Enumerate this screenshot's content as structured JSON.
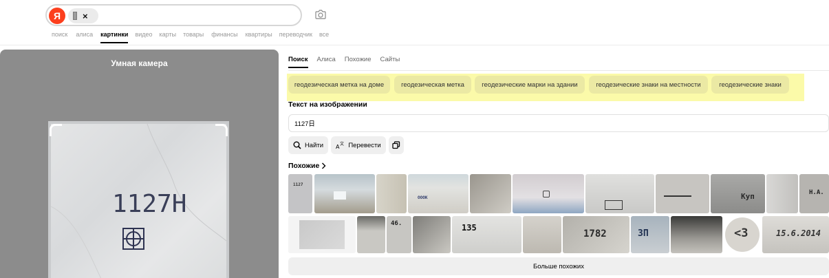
{
  "header": {
    "logo_letter": "Я",
    "chip_close": "×",
    "nav": [
      "поиск",
      "алиса",
      "картинки",
      "видео",
      "карты",
      "товары",
      "финансы",
      "квартиры",
      "переводчик",
      "все"
    ],
    "active_nav": "картинки"
  },
  "left_panel": {
    "title": "Умная камера",
    "photo_text": "1127H"
  },
  "tabs": [
    "Поиск",
    "Алиса",
    "Похожие",
    "Сайты"
  ],
  "suggestions": [
    "геодезическая метка на доме",
    "геодезическая метка",
    "геодезические марки на здании",
    "геодезические знаки на местности",
    "геодезические знаки"
  ],
  "text_section": {
    "title": "Текст на изображении",
    "value": "1127日"
  },
  "actions": {
    "find": "Найти",
    "translate": "Перевести"
  },
  "similar": {
    "title": "Похожие",
    "thumb_labels": [
      "1127",
      "",
      "",
      "ОООК",
      "",
      "",
      "",
      "",
      "",
      "Куп",
      "",
      "Н.А.",
      "",
      "",
      "46.",
      "",
      "135",
      "",
      "1782",
      "ЗП",
      "",
      "<3",
      "15.6.2014"
    ],
    "more": "Больше похожих"
  },
  "colors": {
    "accent_red": "#fc3f1d",
    "highlight": "#fbfaa9",
    "panel_bg": "#8c8c8c"
  }
}
